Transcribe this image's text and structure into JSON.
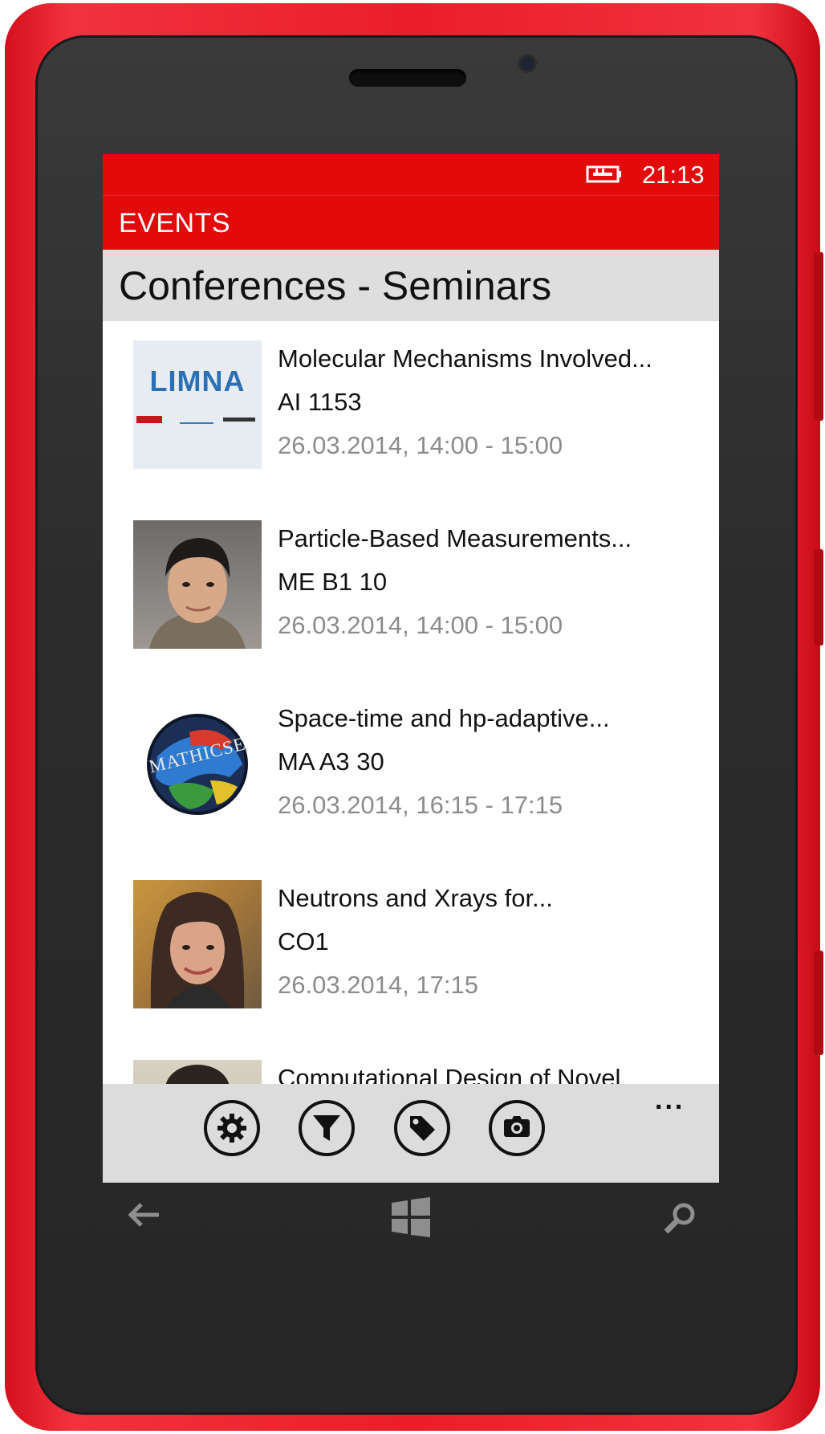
{
  "status_bar": {
    "time": "21:13",
    "battery_icon": "charging-plug-icon"
  },
  "app": {
    "title": "EVENTS"
  },
  "page": {
    "title": "Conferences - Seminars"
  },
  "events": [
    {
      "title": "Molecular Mechanisms Involved...",
      "room": "AI 1153",
      "date": "26.03.2014, 14:00 - 15:00",
      "thumb_text": "LIMNA"
    },
    {
      "title": "Particle-Based Measurements...",
      "room": "ME B1 10",
      "date": "26.03.2014, 14:00 - 15:00"
    },
    {
      "title": "Space-time and hp-adaptive...",
      "room": "MA A3 30",
      "date": "26.03.2014, 16:15 - 17:15",
      "thumb_text": "MATHICSE"
    },
    {
      "title": "Neutrons and Xrays for...",
      "room": "CO1",
      "date": "26.03.2014, 17:15"
    },
    {
      "title": "Computational Design of Novel"
    }
  ],
  "command_bar": {
    "buttons": [
      "settings-gear-icon",
      "filter-funnel-icon",
      "tag-icon",
      "camera-icon"
    ],
    "more": "..."
  },
  "colors": {
    "accent": "#e20a0b",
    "phone_body": "#ea1e2a",
    "header_bg": "#dedede",
    "secondary_text": "#8c8c8c"
  }
}
